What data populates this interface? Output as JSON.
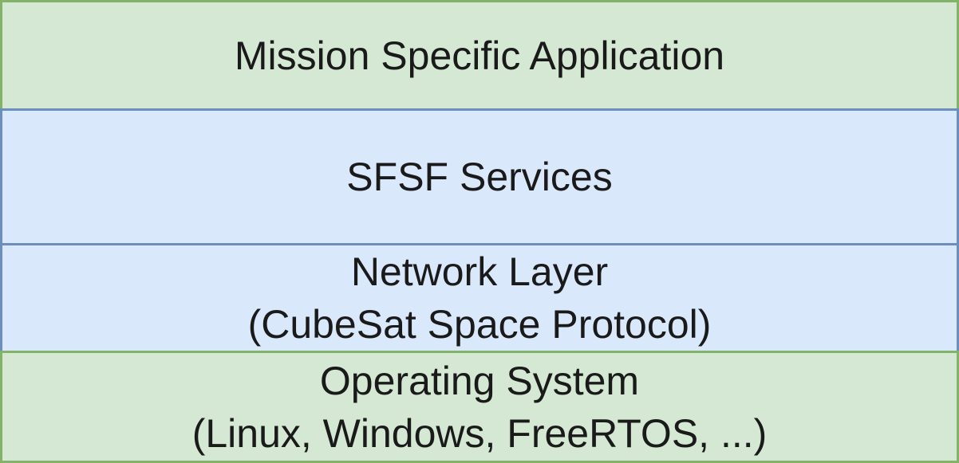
{
  "layers": [
    {
      "lines": [
        "Mission Specific Application"
      ],
      "fill": "#d5e8d4",
      "stroke": "#82b366"
    },
    {
      "lines": [
        "SFSF Services"
      ],
      "fill": "#dae8fc",
      "stroke": "#6c8ebf"
    },
    {
      "lines": [
        "Network Layer",
        "(CubeSat Space Protocol)"
      ],
      "fill": "#dae8fc",
      "stroke": "#6c8ebf"
    },
    {
      "lines": [
        "Operating System",
        "(Linux, Windows, FreeRTOS, ...)"
      ],
      "fill": "#d5e8d4",
      "stroke": "#82b366"
    }
  ]
}
